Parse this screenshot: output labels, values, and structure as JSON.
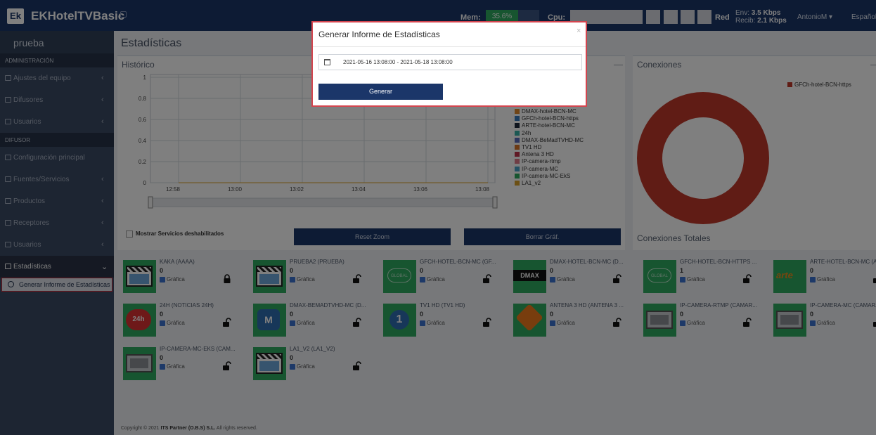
{
  "app": {
    "logo": "Ek",
    "name": "EKHotelTVBasic"
  },
  "header": {
    "mem_label": "Mem:",
    "mem_value": "35.6%",
    "cpu_label": "Cpu:",
    "net_label": "Red",
    "env_label": "Env:",
    "env_value": "3.5 Kbps",
    "recib_label": "Recib:",
    "recib_value": "2.1 Kbps",
    "user": "AntonioM ▾",
    "language": "Español"
  },
  "sidebar": {
    "site": "prueba",
    "section_admin": "ADMINISTRACIÓN",
    "admin_items": [
      {
        "label": "Ajustes del equipo"
      },
      {
        "label": "Difusores"
      },
      {
        "label": "Usuarios"
      }
    ],
    "section_difusor": "DIFUSOR",
    "difusor_items": [
      {
        "label": "Configuración principal"
      },
      {
        "label": "Fuentes/Servicios"
      },
      {
        "label": "Productos"
      },
      {
        "label": "Receptores"
      },
      {
        "label": "Usuarios"
      },
      {
        "label": "Estadísticas"
      }
    ],
    "submenu_label": "Generar Informe de Estadísticas"
  },
  "page": {
    "title": "Estadísticas"
  },
  "historico": {
    "title": "Histórico",
    "minimize": "—",
    "y_ticks": [
      "1",
      "0.8",
      "0.6",
      "0.4",
      "0.2",
      "0"
    ],
    "x_ticks": [
      "12:58",
      "13:00",
      "13:02",
      "13:04",
      "13:06",
      "13:08"
    ],
    "legend": [
      {
        "name": "DMAX-hotel-BCN-MC",
        "color": "#e08a2e"
      },
      {
        "name": "GFCh-hotel-BCN-https",
        "color": "#3b7dbf"
      },
      {
        "name": "ARTE-hotel-BCN-MC",
        "color": "#1e2a3c"
      },
      {
        "name": "24h",
        "color": "#38b0a6"
      },
      {
        "name": "DMAX-BeMadTVHD-MC",
        "color": "#5a6dbd"
      },
      {
        "name": "TV1 HD",
        "color": "#d9742a"
      },
      {
        "name": "Antena 3 HD",
        "color": "#c0334a"
      },
      {
        "name": "IP-camera-rtmp",
        "color": "#e07a8a"
      },
      {
        "name": "IP-camera-MC",
        "color": "#4aa3c9"
      },
      {
        "name": "IP-camera-MC-EkS",
        "color": "#2eab61"
      },
      {
        "name": "LA1_v2",
        "color": "#d9a12a"
      }
    ],
    "checkbox_label": "Mostrar Servicios deshabilitados",
    "reset_zoom": "Reset Zoom",
    "borrar": "Borrar Gráf."
  },
  "conexiones": {
    "title": "Conexiones",
    "minimize": "—",
    "legend": [
      {
        "name": "GFCh-hotel-BCN-https",
        "color": "#c0392b"
      }
    ],
    "total_label": "Conexiones Totales"
  },
  "chart_data": [
    {
      "type": "line",
      "x": [
        "12:58",
        "13:00",
        "13:02",
        "13:04",
        "13:06",
        "13:08"
      ],
      "ylim": [
        0,
        1
      ],
      "series": [
        {
          "name": "DMAX-hotel-BCN-MC",
          "values": [
            0,
            0,
            0,
            0,
            0,
            0
          ]
        },
        {
          "name": "GFCh-hotel-BCN-https",
          "values": [
            0,
            0,
            0,
            0,
            0,
            0
          ]
        },
        {
          "name": "ARTE-hotel-BCN-MC",
          "values": [
            0,
            0,
            0,
            0,
            0,
            0
          ]
        },
        {
          "name": "24h",
          "values": [
            0,
            0,
            0,
            0,
            0,
            0
          ]
        },
        {
          "name": "DMAX-BeMadTVHD-MC",
          "values": [
            0,
            0,
            0,
            0,
            0,
            0
          ]
        },
        {
          "name": "TV1 HD",
          "values": [
            0,
            0,
            0,
            0,
            0,
            0
          ]
        },
        {
          "name": "Antena 3 HD",
          "values": [
            0,
            0,
            0,
            0,
            0,
            0
          ]
        },
        {
          "name": "IP-camera-rtmp",
          "values": [
            0,
            0,
            0,
            0,
            0,
            0
          ]
        },
        {
          "name": "IP-camera-MC",
          "values": [
            0,
            0,
            0,
            0,
            0,
            0
          ]
        },
        {
          "name": "IP-camera-MC-EkS",
          "values": [
            0,
            0,
            0,
            0,
            0,
            0
          ]
        },
        {
          "name": "LA1_v2",
          "values": [
            0,
            0,
            0,
            0,
            0,
            0
          ]
        }
      ],
      "grid": true,
      "legend": "right"
    },
    {
      "type": "pie",
      "categories": [
        "GFCh-hotel-BCN-https"
      ],
      "values": [
        1
      ],
      "legend": "top-right"
    }
  ],
  "tiles": [
    {
      "name": "KAKA (AAAA)",
      "count": "0",
      "graf": "Gráfica",
      "locked": true,
      "thumb": "clapper"
    },
    {
      "name": "PRUEBA2 (PRUEBA)",
      "count": "0",
      "graf": "Gráfica",
      "locked": false,
      "thumb": "clapper"
    },
    {
      "name": "GFCH-HOTEL-BCN-MC (GF...",
      "count": "0",
      "graf": "Gráfica",
      "locked": false,
      "thumb": "globe"
    },
    {
      "name": "DMAX-HOTEL-BCN-MC (D...",
      "count": "0",
      "graf": "Gráfica",
      "locked": false,
      "thumb": "dmax"
    },
    {
      "name": "GFCH-HOTEL-BCN-HTTPS ...",
      "count": "1",
      "graf": "Gráfica",
      "locked": false,
      "thumb": "globe"
    },
    {
      "name": "ARTE-HOTEL-BCN-MC (AR...",
      "count": "0",
      "graf": "Gráfica",
      "locked": false,
      "thumb": "arte"
    },
    {
      "name": "24H (NOTICIAS 24H)",
      "count": "0",
      "graf": "Gráfica",
      "locked": false,
      "thumb": "24h"
    },
    {
      "name": "DMAX-BEMADTVHD-MC (D...",
      "count": "0",
      "graf": "Gráfica",
      "locked": false,
      "thumb": "m"
    },
    {
      "name": "TV1 HD (TV1 HD)",
      "count": "0",
      "graf": "Gráfica",
      "locked": false,
      "thumb": "tv1"
    },
    {
      "name": "ANTENA 3 HD (ANTENA 3 ...",
      "count": "0",
      "graf": "Gráfica",
      "locked": false,
      "thumb": "antena3"
    },
    {
      "name": "IP-CAMERA-RTMP (CAMAR...",
      "count": "0",
      "graf": "Gráfica",
      "locked": false,
      "thumb": "camera"
    },
    {
      "name": "IP-CAMERA-MC (CAMARA-I",
      "count": "0",
      "graf": "Gráfica",
      "locked": false,
      "thumb": "camera"
    },
    {
      "name": "IP-CAMERA-MC-EKS (CAM...",
      "count": "0",
      "graf": "Gráfica",
      "locked": false,
      "thumb": "camera"
    },
    {
      "name": "LA1_V2 (LA1_V2)",
      "count": "0",
      "graf": "Gráfica",
      "locked": false,
      "thumb": "clapper"
    }
  ],
  "footer": {
    "prefix": "Copyright © 2021 ",
    "company": "ITS Partner (O.B.S) S.L.",
    "suffix": " All rights reserved."
  },
  "modal": {
    "title": "Generar Informe de Estadísticas",
    "close": "×",
    "date_range": "2021-05-16 13:08:00 - 2021-05-18 13:08:00",
    "button": "Generar"
  }
}
